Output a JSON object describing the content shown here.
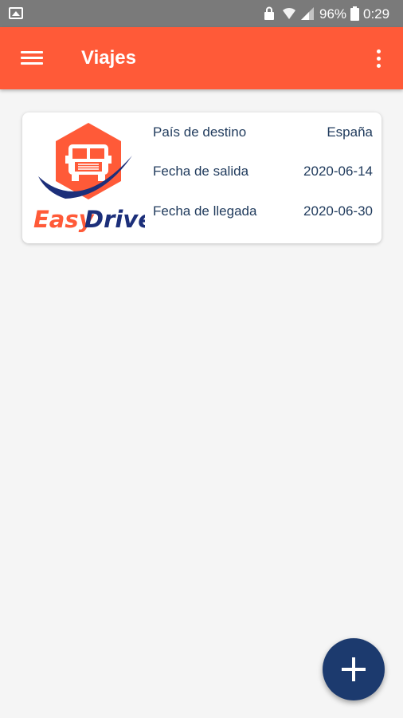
{
  "status_bar": {
    "battery_percent": "96%",
    "time": "0:29"
  },
  "app_bar": {
    "title": "Viajes"
  },
  "trips": [
    {
      "logo_text": "EasyDrive",
      "fields": [
        {
          "label": "País de destino",
          "value": "España"
        },
        {
          "label": "Fecha de salida",
          "value": "2020-06-14"
        },
        {
          "label": "Fecha de llegada",
          "value": "2020-06-30"
        }
      ]
    }
  ],
  "colors": {
    "app_bar": "#ff5a38",
    "fab": "#1c3a6e",
    "text": "#1f3a5c",
    "logo_orange": "#ff5a38",
    "logo_navy": "#1c2f7a"
  },
  "icons": {
    "menu": "hamburger-menu-icon",
    "overflow": "more-vert-icon",
    "fab": "plus-icon"
  }
}
